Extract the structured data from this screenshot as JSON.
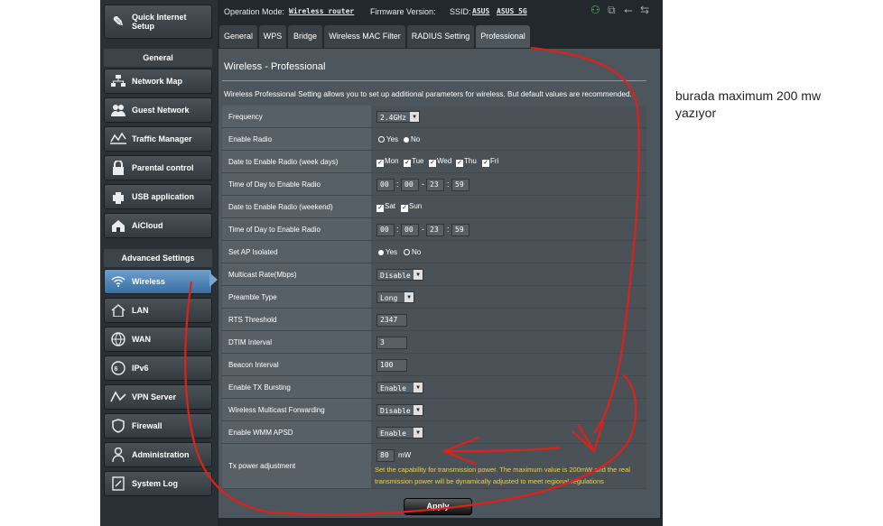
{
  "topbar": {
    "operation_mode_label": "Operation Mode:",
    "operation_mode_value": "Wireless router",
    "firmware_label": "Firmware Version:",
    "ssid_label": "SSID:",
    "ssid_value_1": "ASUS",
    "ssid_value_2": "ASUS_5G"
  },
  "sidebar": {
    "quick_setup": "Quick Internet Setup",
    "general_header": "General",
    "general_items": [
      {
        "label": "Network Map",
        "icon": "network-map-icon"
      },
      {
        "label": "Guest Network",
        "icon": "guest-network-icon"
      },
      {
        "label": "Traffic Manager",
        "icon": "traffic-manager-icon"
      },
      {
        "label": "Parental control",
        "icon": "parental-control-icon"
      },
      {
        "label": "USB application",
        "icon": "usb-application-icon"
      },
      {
        "label": "AiCloud",
        "icon": "aicloud-icon"
      }
    ],
    "advanced_header": "Advanced Settings",
    "advanced_items": [
      {
        "label": "Wireless",
        "icon": "wireless-icon",
        "active": true
      },
      {
        "label": "LAN",
        "icon": "lan-icon"
      },
      {
        "label": "WAN",
        "icon": "wan-icon"
      },
      {
        "label": "IPv6",
        "icon": "ipv6-icon"
      },
      {
        "label": "VPN Server",
        "icon": "vpn-server-icon"
      },
      {
        "label": "Firewall",
        "icon": "firewall-icon"
      },
      {
        "label": "Administration",
        "icon": "administration-icon"
      },
      {
        "label": "System Log",
        "icon": "system-log-icon"
      }
    ]
  },
  "tabs": [
    "General",
    "WPS",
    "Bridge",
    "Wireless MAC Filter",
    "RADIUS Setting",
    "Professional"
  ],
  "active_tab": "Professional",
  "panel": {
    "title": "Wireless - Professional",
    "description": "Wireless Professional Setting allows you to set up additional parameters for wireless. But default values are recommended.",
    "apply_label": "Apply"
  },
  "settings": {
    "frequency": {
      "label": "Frequency",
      "value": "2.4GHz"
    },
    "enable_radio": {
      "label": "Enable Radio",
      "yes": "Yes",
      "no": "No",
      "selected": "Yes"
    },
    "date_weekdays": {
      "label": "Date to Enable Radio (week days)",
      "days": [
        "Mon",
        "Tue",
        "Wed",
        "Thu",
        "Fri"
      ]
    },
    "time_weekdays": {
      "label": "Time of Day to Enable Radio",
      "start_h": "00",
      "start_m": "00",
      "end_h": "23",
      "end_m": "59"
    },
    "date_weekend": {
      "label": "Date to Enable Radio (weekend)",
      "days": [
        "Sat",
        "Sun"
      ]
    },
    "time_weekend": {
      "label": "Time of Day to Enable Radio",
      "start_h": "00",
      "start_m": "00",
      "end_h": "23",
      "end_m": "59"
    },
    "ap_isolated": {
      "label": "Set AP Isolated",
      "yes": "Yes",
      "no": "No",
      "selected": "No"
    },
    "multicast_rate": {
      "label": "Multicast Rate(Mbps)",
      "value": "Disable"
    },
    "preamble": {
      "label": "Preamble Type",
      "value": "Long"
    },
    "rts": {
      "label": "RTS Threshold",
      "value": "2347"
    },
    "dtim": {
      "label": "DTIM Interval",
      "value": "3"
    },
    "beacon": {
      "label": "Beacon Interval",
      "value": "100"
    },
    "tx_bursting": {
      "label": "Enable TX Bursting",
      "value": "Enable"
    },
    "multicast_forwarding": {
      "label": "Wireless Multicast Forwarding",
      "value": "Disable"
    },
    "wmm_apsd": {
      "label": "Enable WMM APSD",
      "value": "Enable"
    },
    "tx_power": {
      "label": "Tx power adjustment",
      "value": "80",
      "unit": "mW",
      "note_line1": "Set the capability for transmission power. The maximum value is 200mW and the real",
      "note_line2": "transmission power will be dynamically adjusted to meet regional regulations"
    }
  },
  "annotation": {
    "text_line1": "burada maximum 200 mw",
    "text_line2": "yazıyor"
  },
  "colors": {
    "sidebar_bg": "#2a3035",
    "panel_bg": "#4d565c",
    "active_item": "#4a7fb3",
    "warning_text": "#f4d03f",
    "scribble": "#e0201a"
  }
}
